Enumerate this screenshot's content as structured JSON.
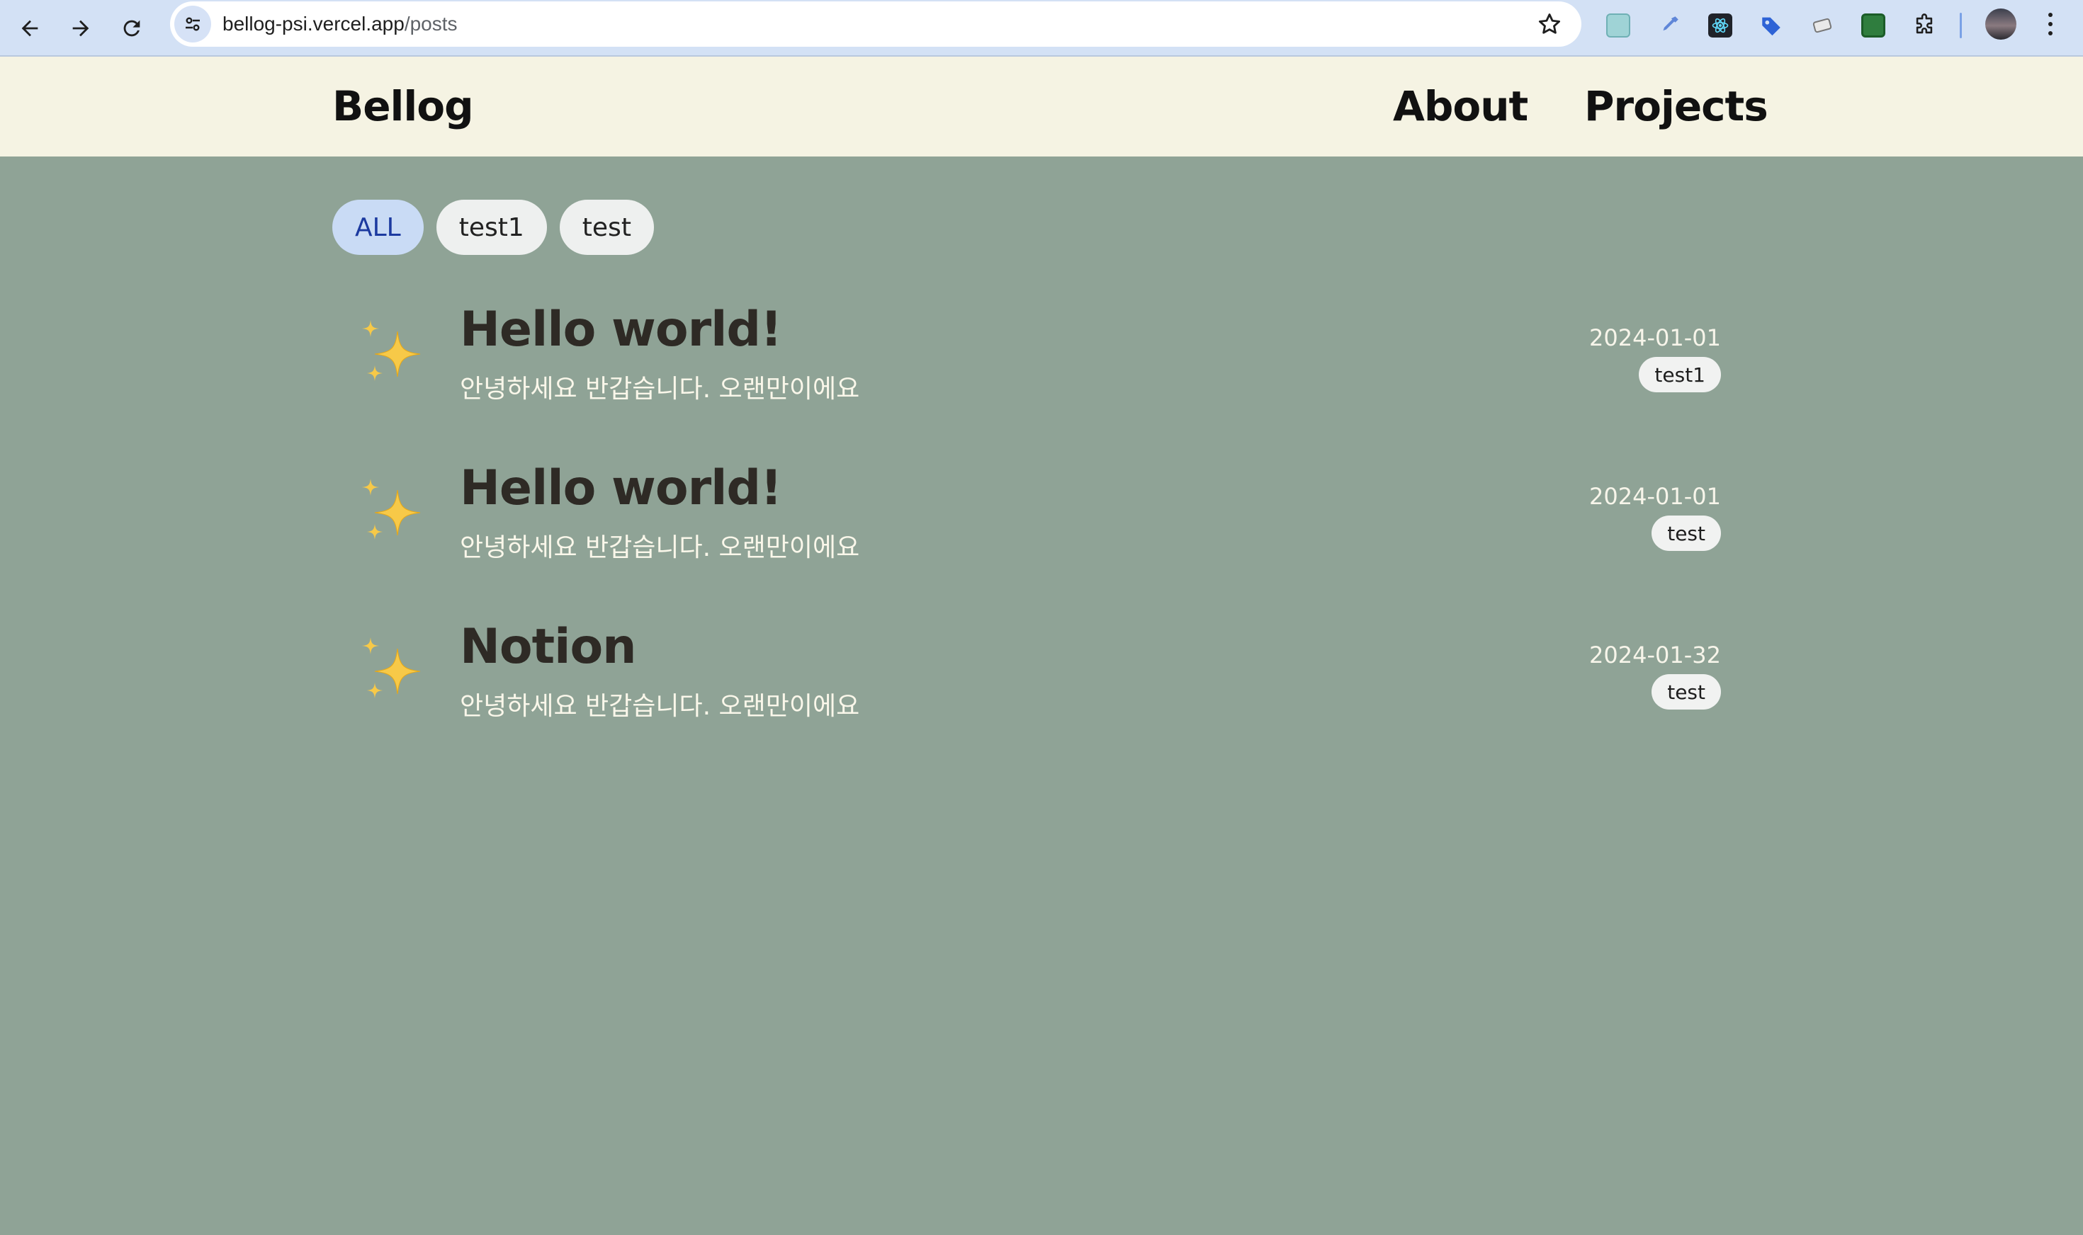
{
  "browser": {
    "url_host": "bellog-psi.vercel.app",
    "url_path": "/posts",
    "back_icon": "arrow-left-icon",
    "forward_icon": "arrow-right-icon",
    "reload_icon": "reload-icon",
    "bookmark_icon": "star-icon",
    "extensions": [
      "color-picker-extension",
      "eyedropper-extension",
      "react-devtools-extension",
      "tag-extension",
      "eraser-extension",
      "sheet-extension",
      "puzzle-icon"
    ]
  },
  "header": {
    "logo": "Bellog",
    "nav": [
      {
        "label": "About"
      },
      {
        "label": "Projects"
      }
    ]
  },
  "filters": [
    {
      "label": "ALL",
      "active": true
    },
    {
      "label": "test1",
      "active": false
    },
    {
      "label": "test",
      "active": false
    }
  ],
  "posts": [
    {
      "icon": "sparkles-icon",
      "title": "Hello world!",
      "description": "안녕하세요 반갑습니다. 오랜만이에요",
      "date": "2024-01-01",
      "tag": "test1"
    },
    {
      "icon": "sparkles-icon",
      "title": "Hello world!",
      "description": "안녕하세요 반갑습니다. 오랜만이에요",
      "date": "2024-01-01",
      "tag": "test"
    },
    {
      "icon": "sparkles-icon",
      "title": "Notion",
      "description": "안녕하세요 반갑습니다. 오랜만이에요",
      "date": "2024-01-32",
      "tag": "test"
    }
  ],
  "colors": {
    "page_background": "#8fa396",
    "header_background": "#f5f3e3",
    "active_chip": "#c9dbf5",
    "chip": "#eef0ef",
    "title_text": "#2e2a25"
  }
}
